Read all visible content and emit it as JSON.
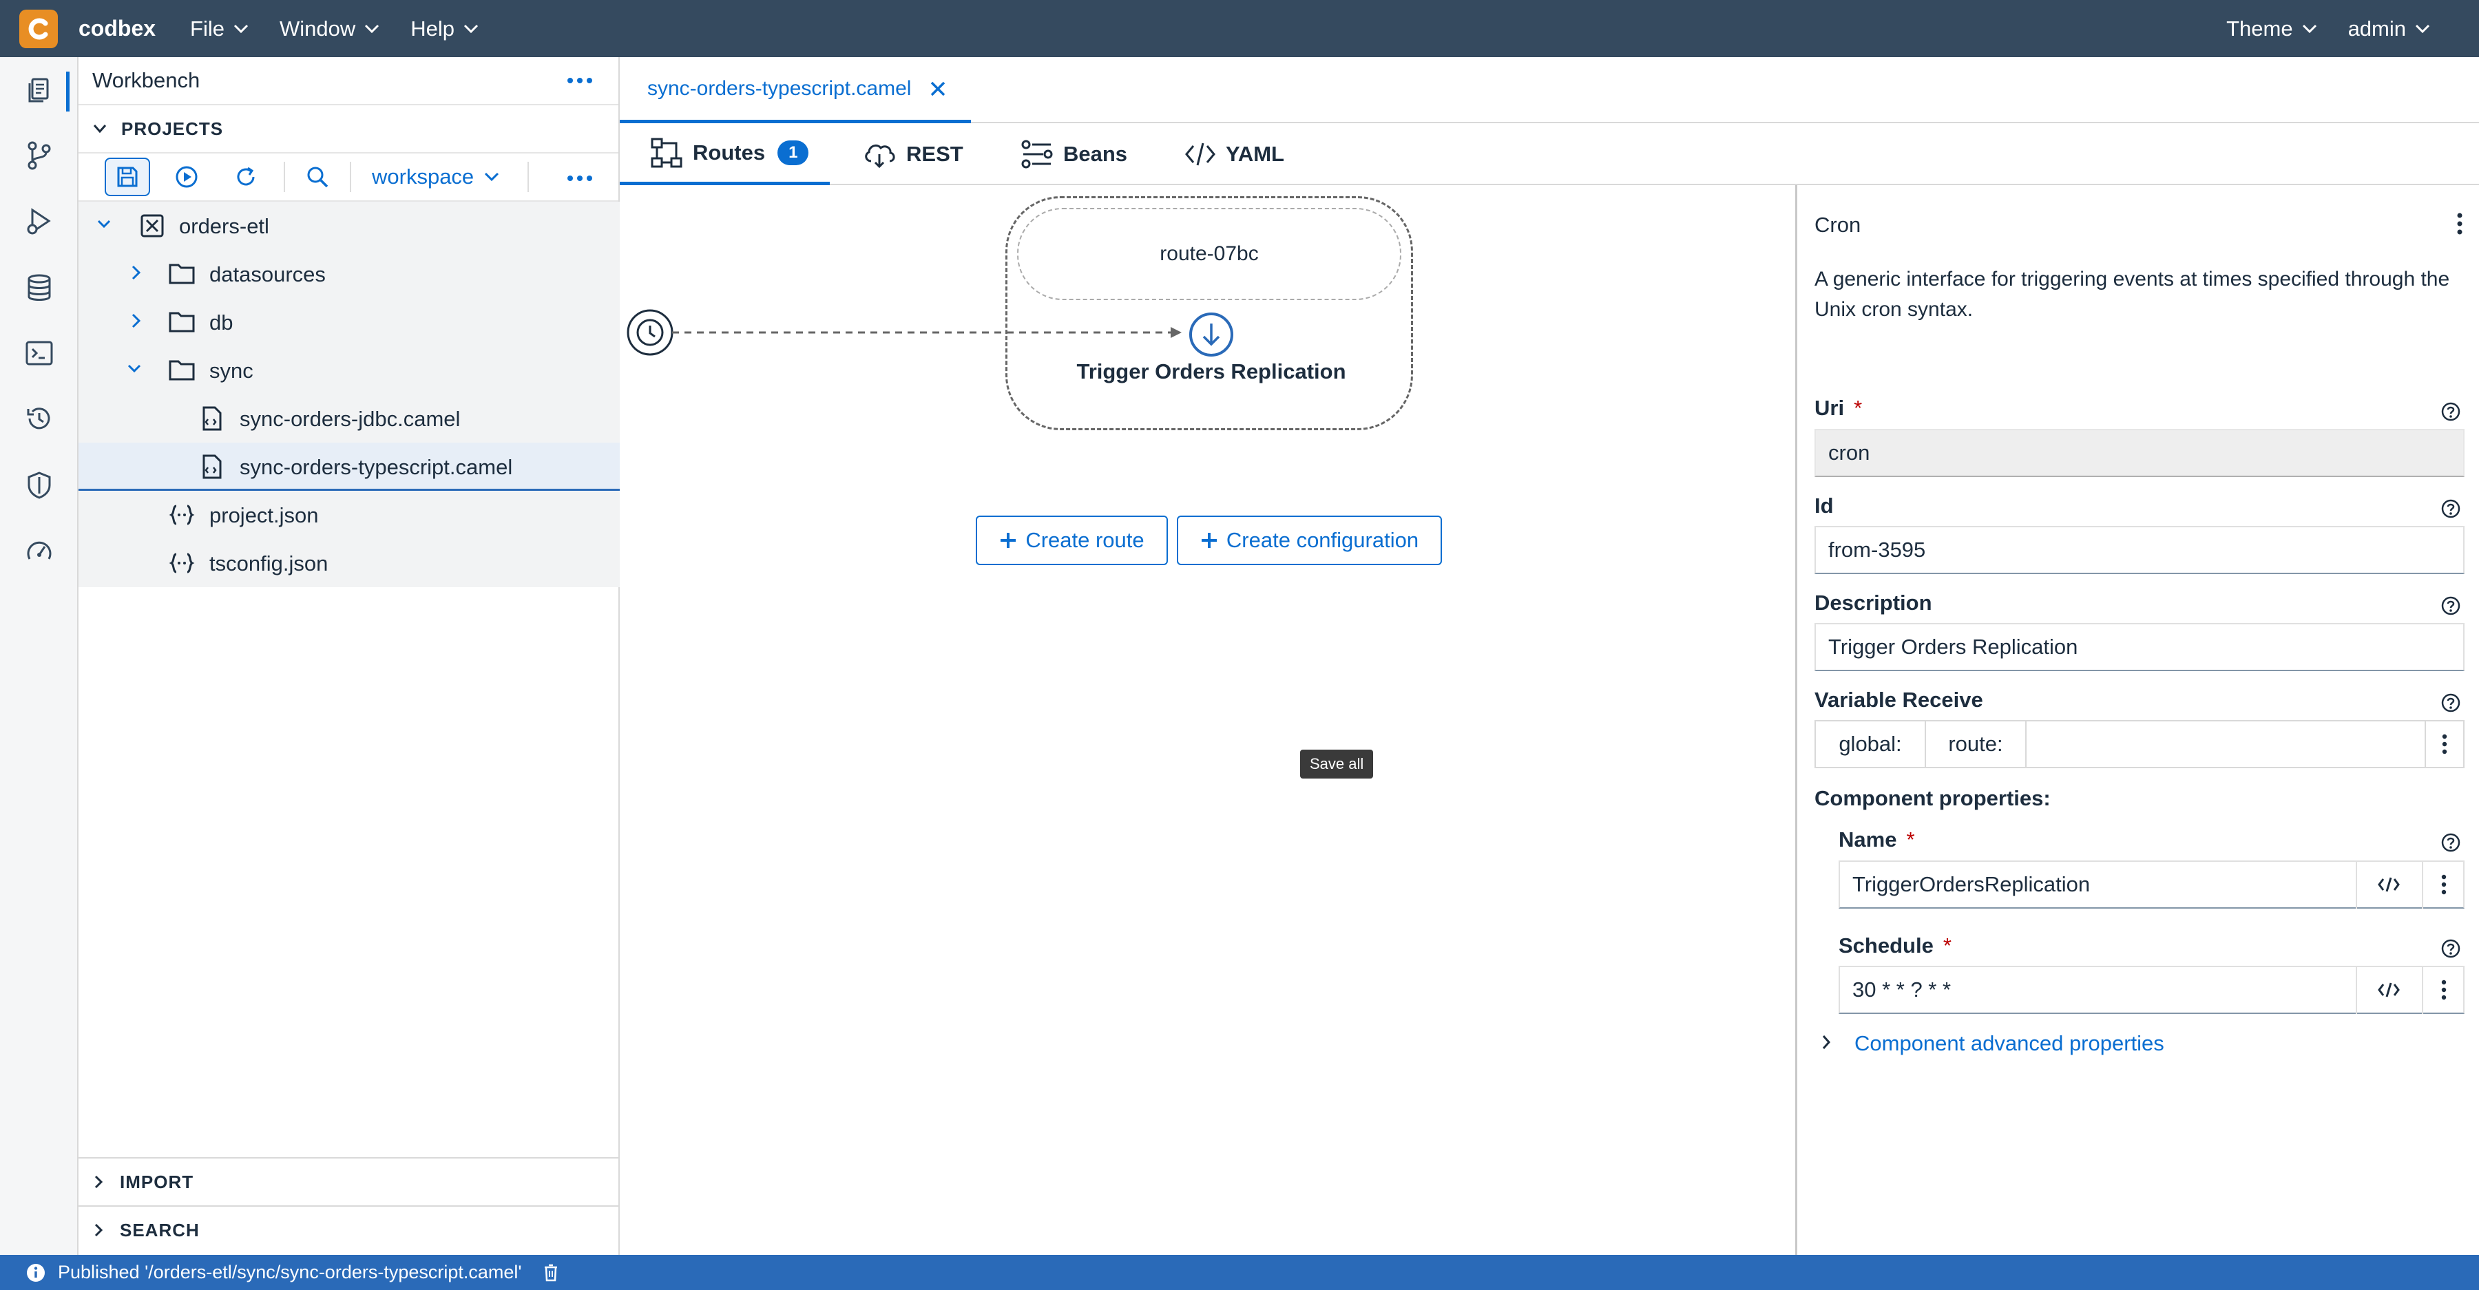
{
  "app": {
    "brand": "codbex"
  },
  "menu": {
    "file": "File",
    "window": "Window",
    "help": "Help",
    "theme": "Theme",
    "user": "admin"
  },
  "explorer": {
    "title": "Workbench",
    "projects_label": "PROJECTS",
    "workspace": "workspace",
    "tree": {
      "project": "orders-etl",
      "datasources": "datasources",
      "db": "db",
      "sync": "sync",
      "file1": "sync-orders-jdbc.camel",
      "file2": "sync-orders-typescript.camel",
      "file3": "project.json",
      "file4": "tsconfig.json"
    },
    "import_label": "IMPORT",
    "search_label": "SEARCH"
  },
  "editor": {
    "file_tab": "sync-orders-typescript.camel",
    "tabs": {
      "routes": "Routes",
      "routes_count": "1",
      "rest": "REST",
      "beans": "Beans",
      "yaml": "YAML"
    },
    "route": {
      "name": "route-07bc",
      "step": "Trigger Orders Replication"
    },
    "create_route": "Create route",
    "create_configuration": "Create configuration",
    "tooltip": "Save all"
  },
  "props": {
    "title": "Cron",
    "description": "A generic interface for triggering events at times specified through the Unix cron syntax.",
    "uri_label": "Uri",
    "uri_value": "cron",
    "id_label": "Id",
    "id_value": "from-3595",
    "desc_label": "Description",
    "desc_value": "Trigger Orders Replication",
    "varrecv_label": "Variable Receive",
    "global": "global:",
    "route": "route:",
    "comp_props": "Component properties:",
    "name_label": "Name",
    "name_value": "TriggerOrdersReplication",
    "schedule_label": "Schedule",
    "schedule_value": "30 * * ? * *",
    "advanced": "Component advanced properties",
    "required_mark": "*"
  },
  "status": {
    "message": "Published '/orders-etl/sync/sync-orders-typescript.camel'"
  },
  "colors": {
    "topbar": "#354a5f",
    "accent": "#0a6ed1",
    "status": "#2a6ab8",
    "logo": "#e88e24"
  }
}
